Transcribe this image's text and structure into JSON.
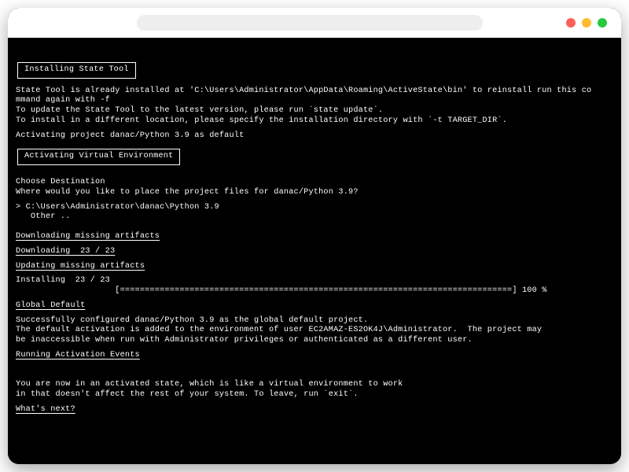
{
  "headings": {
    "installing": "Installing State Tool",
    "activating_env": "Activating Virtual Environment",
    "downloading_missing": "Downloading missing artifacts",
    "updating_missing": "Updating missing artifacts",
    "global_default": "Global Default",
    "running_events": "Running Activation Events"
  },
  "messages": {
    "already_installed_1": "State Tool is already installed at 'C:\\Users\\Administrator\\AppData\\Roaming\\ActiveState\\bin' to reinstall run this co",
    "already_installed_2": "mmand again with -f",
    "update_hint": "To update the State Tool to the latest version, please run `state update`.",
    "diff_location": "To install in a different location, please specify the installation directory with `-t TARGET_DIR`.",
    "activating_project": "Activating project danac/Python 3.9 as default",
    "choose_dest": "Choose Destination",
    "where_place": "Where would you like to place the project files for danac/Python 3.9?",
    "path_option": "> C:\\Users\\Administrator\\danac\\Python 3.9",
    "other_option": "   Other ..",
    "downloading_count": "Downloading  23 / 23",
    "installing_count": "Installing  23 / 23",
    "progress_bar": "                    [===============================================================================] 100 %",
    "success_1": "Successfully configured danac/Python 3.9 as the global default project.",
    "success_2": "The default activation is added to the environment of user EC2AMAZ-ES2OK4J\\Administrator.  The project may",
    "success_3": "be inaccessible when run with Administrator privileges or authenticated as a different user.",
    "activated_1": "You are now in an activated state, which is like a virtual environment to work",
    "activated_2": "in that doesn't affect the rest of your system. To leave, run `exit`.",
    "whats_next": "What's next?"
  }
}
